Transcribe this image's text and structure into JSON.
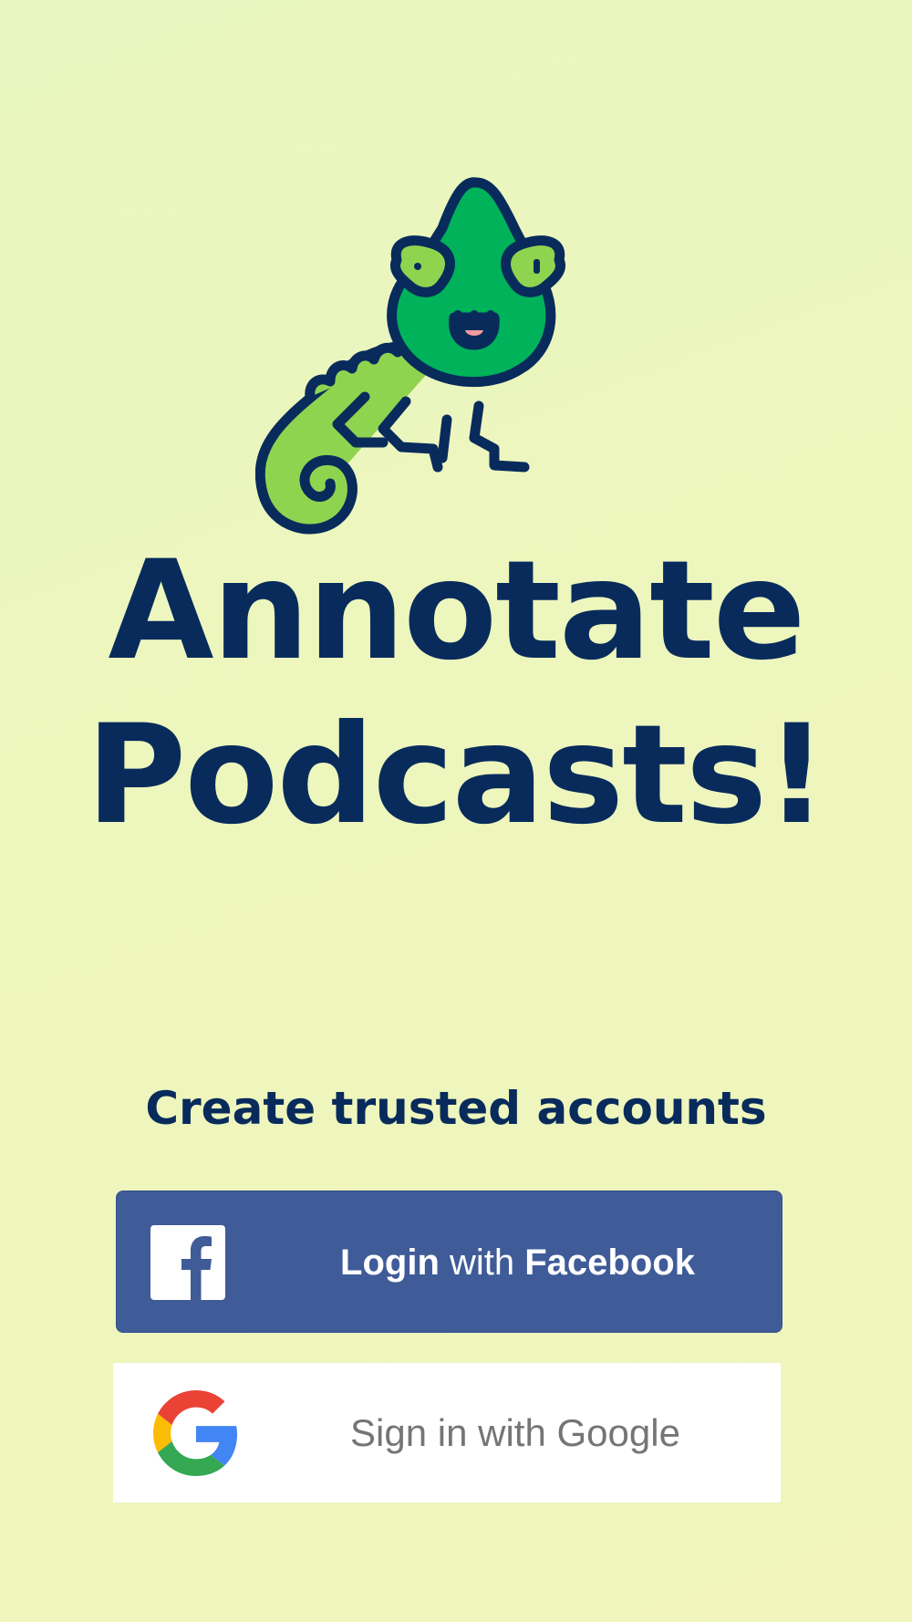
{
  "mascot": {
    "icon": "chameleon-mascot-icon",
    "body_color": "#00b25a",
    "light_green": "#8fd44f",
    "outline_color": "#082b5c"
  },
  "headline": {
    "line1": "Annotate",
    "line2": "Podcasts!"
  },
  "subtitle": "Create trusted accounts",
  "facebook_button": {
    "part1": "Login",
    "part2": " with ",
    "part3": "Facebook",
    "icon": "facebook-icon",
    "color": "#3f5b98"
  },
  "google_button": {
    "label": "Sign in with Google",
    "icon": "google-icon"
  },
  "colors": {
    "text_dark": "#082b5c",
    "background": "#edf6bd"
  }
}
